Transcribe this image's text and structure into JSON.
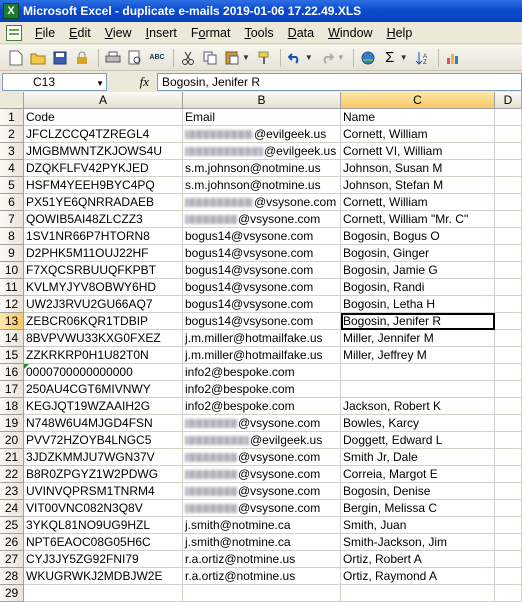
{
  "window": {
    "title": "Microsoft Excel - duplicate e-mails 2019-01-06 17.22.49.XLS"
  },
  "menu": [
    {
      "pre": "",
      "ul": "F",
      "post": "ile"
    },
    {
      "pre": "",
      "ul": "E",
      "post": "dit"
    },
    {
      "pre": "",
      "ul": "V",
      "post": "iew"
    },
    {
      "pre": "",
      "ul": "I",
      "post": "nsert"
    },
    {
      "pre": "F",
      "ul": "o",
      "post": "rmat"
    },
    {
      "pre": "",
      "ul": "T",
      "post": "ools"
    },
    {
      "pre": "",
      "ul": "D",
      "post": "ata"
    },
    {
      "pre": "",
      "ul": "W",
      "post": "indow"
    },
    {
      "pre": "",
      "ul": "H",
      "post": "elp"
    }
  ],
  "toolbar": {
    "icons": [
      "new-icon",
      "open-icon",
      "save-icon",
      "permission-icon",
      "print-icon",
      "print-preview-icon",
      "spelling-icon",
      "cut-icon",
      "copy-icon",
      "paste-icon",
      "format-painter-icon",
      "undo-icon",
      "redo-icon",
      "hyperlink-icon",
      "autosum-icon",
      "sort-icon",
      "chart-icon"
    ],
    "autosum_glyph": "Σ",
    "spell_glyph": "ABC"
  },
  "formula_bar": {
    "name_box": "C13",
    "fx": "fx",
    "content": "Bogosin, Jenifer R"
  },
  "columns": [
    "A",
    "B",
    "C",
    "D"
  ],
  "active_column": "C",
  "active_row": 13,
  "rows": [
    {
      "n": "1",
      "a": "Code",
      "b": "Email",
      "b_blur": 0,
      "c": "Name"
    },
    {
      "n": "2",
      "a": "JFCLZCCQ4TZREGL4",
      "b": "@evilgeek.us",
      "b_blur": 68,
      "c": "Cornett, William"
    },
    {
      "n": "3",
      "a": "JMGBMWNTZKJOWS4U",
      "b": "@evilgeek.us",
      "b_blur": 78,
      "c": "Cornett VI, William"
    },
    {
      "n": "4",
      "a": "DZQKFLFV42PYKJED",
      "b": "s.m.johnson@notmine.us",
      "b_blur": 0,
      "c": "Johnson, Susan M"
    },
    {
      "n": "5",
      "a": "HSFM4YEEH9BYC4PQ",
      "b": "s.m.johnson@notmine.us",
      "b_blur": 0,
      "c": "Johnson, Stefan M"
    },
    {
      "n": "6",
      "a": "PX51YE6QNRRADAEB",
      "b": "@vsysone.com",
      "b_blur": 68,
      "c": "Cornett, William"
    },
    {
      "n": "7",
      "a": "QOWIB5AI48ZLCZZ3",
      "b": "@vsysone.com",
      "b_blur": 52,
      "c": "Cornett, William \"Mr. C\""
    },
    {
      "n": "8",
      "a": "1SV1NR66P7HTORN8",
      "b": "bogus14@vsysone.com",
      "b_blur": 0,
      "c": "Bogosin, Bogus O"
    },
    {
      "n": "9",
      "a": "D2PHK5M11OUJ22HF",
      "b": "bogus14@vsysone.com",
      "b_blur": 0,
      "c": "Bogosin, Ginger"
    },
    {
      "n": "10",
      "a": "F7XQCSRBUUQFKPBT",
      "b": "bogus14@vsysone.com",
      "b_blur": 0,
      "c": "Bogosin, Jamie G"
    },
    {
      "n": "11",
      "a": "KVLMYJYV8OBWY6HD",
      "b": "bogus14@vsysone.com",
      "b_blur": 0,
      "c": "Bogosin, Randi"
    },
    {
      "n": "12",
      "a": "UW2J3RVU2GU66AQ7",
      "b": "bogus14@vsysone.com",
      "b_blur": 0,
      "c": "Bogosin, Letha H"
    },
    {
      "n": "13",
      "a": "ZEBCR06KQR1TDBIP",
      "b": "bogus14@vsysone.com",
      "b_blur": 0,
      "c": "Bogosin, Jenifer R"
    },
    {
      "n": "14",
      "a": "8BVPVWU33KXG0FXEZ",
      "b": "j.m.miller@hotmailfake.us",
      "b_blur": 0,
      "c": "Miller, Jennifer M"
    },
    {
      "n": "15",
      "a": "ZZKRKRP0H1U82T0N",
      "b": "j.m.miller@hotmailfake.us",
      "b_blur": 0,
      "c": "Miller, Jeffrey M"
    },
    {
      "n": "16",
      "a": "0000700000000000",
      "b": "info2@bespoke.com",
      "b_blur": 0,
      "c": "",
      "tri": true
    },
    {
      "n": "17",
      "a": "250AU4CGT6MIVNWY",
      "b": "info2@bespoke.com",
      "b_blur": 0,
      "c": ""
    },
    {
      "n": "18",
      "a": "KEGJQT19WZAAIH2G",
      "b": "info2@bespoke.com",
      "b_blur": 0,
      "c": "Jackson, Robert K"
    },
    {
      "n": "19",
      "a": "N748W6U4MJGD4FSN",
      "b": "@vsysone.com",
      "b_blur": 52,
      "c": "Bowles, Karcy"
    },
    {
      "n": "20",
      "a": "PVV72HZOYB4LNGC5",
      "b": "@evilgeek.us",
      "b_blur": 64,
      "c": "Doggett, Edward L"
    },
    {
      "n": "21",
      "a": "3JDZKMMJU7WGN37V",
      "b": "@vsysone.com",
      "b_blur": 52,
      "c": "Smith Jr, Dale"
    },
    {
      "n": "22",
      "a": "B8R0ZPGYZ1W2PDWG",
      "b": "@vsysone.com",
      "b_blur": 52,
      "c": "Correia, Margot E"
    },
    {
      "n": "23",
      "a": "UVINVQPRSM1TNRM4",
      "b": "@vsysone.com",
      "b_blur": 52,
      "c": "Bogosin, Denise"
    },
    {
      "n": "24",
      "a": "VIT00VNC082N3Q8V",
      "b": "@vsysone.com",
      "b_blur": 52,
      "c": "Bergin, Melissa C"
    },
    {
      "n": "25",
      "a": "3YKQL81NO9UG9HZL",
      "b": "j.smith@notmine.ca",
      "b_blur": 0,
      "c": "Smith, Juan"
    },
    {
      "n": "26",
      "a": "NPT6EAOC08G05H6C",
      "b": "j.smith@notmine.ca",
      "b_blur": 0,
      "c": "Smith-Jackson, Jim"
    },
    {
      "n": "27",
      "a": "CYJ3JY5ZG92FNI79",
      "b": "r.a.ortiz@notmine.us",
      "b_blur": 0,
      "c": "Ortiz, Robert A"
    },
    {
      "n": "28",
      "a": "WKUGRWKJ2MDBJW2E",
      "b": "r.a.ortiz@notmine.us",
      "b_blur": 0,
      "c": "Ortiz, Raymond A"
    },
    {
      "n": "29",
      "a": "",
      "b": "",
      "b_blur": 0,
      "c": ""
    }
  ]
}
